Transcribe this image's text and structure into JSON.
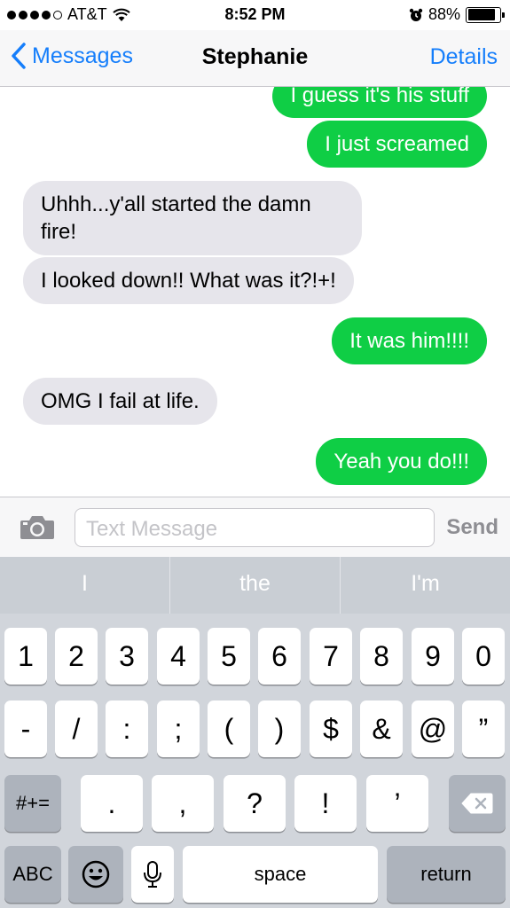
{
  "status_bar": {
    "carrier": "AT&T",
    "time": "8:52 PM",
    "battery_percent": "88%",
    "battery_level": 0.88
  },
  "nav": {
    "back_label": "Messages",
    "title": "Stephanie",
    "details_label": "Details"
  },
  "messages": [
    {
      "direction": "out",
      "text": "I guess it's his stuff"
    },
    {
      "direction": "out",
      "text": "I just screamed"
    },
    {
      "direction": "in",
      "text": "Uhhh...y'all started the damn fire!"
    },
    {
      "direction": "in",
      "text": "I looked down!! What was it?!+!"
    },
    {
      "direction": "out",
      "text": "It was him!!!!"
    },
    {
      "direction": "in",
      "text": "OMG I fail at life."
    },
    {
      "direction": "out",
      "text": "Yeah you do!!!"
    }
  ],
  "composer": {
    "placeholder": "Text Message",
    "send_label": "Send"
  },
  "keyboard": {
    "suggestions": [
      "I",
      "the",
      "I'm"
    ],
    "row1": [
      "1",
      "2",
      "3",
      "4",
      "5",
      "6",
      "7",
      "8",
      "9",
      "0"
    ],
    "row2": [
      "-",
      "/",
      ":",
      ";",
      "(",
      ")",
      "$",
      "&",
      "@",
      "”"
    ],
    "row3": [
      ".",
      ",",
      "?",
      "!",
      "’"
    ],
    "symbols_label": "#+=",
    "abc_label": "ABC",
    "space_label": "space",
    "return_label": "return"
  },
  "colors": {
    "accent": "#157efb",
    "outgoing_bubble": "#0fce45",
    "incoming_bubble": "#e6e5eb"
  }
}
